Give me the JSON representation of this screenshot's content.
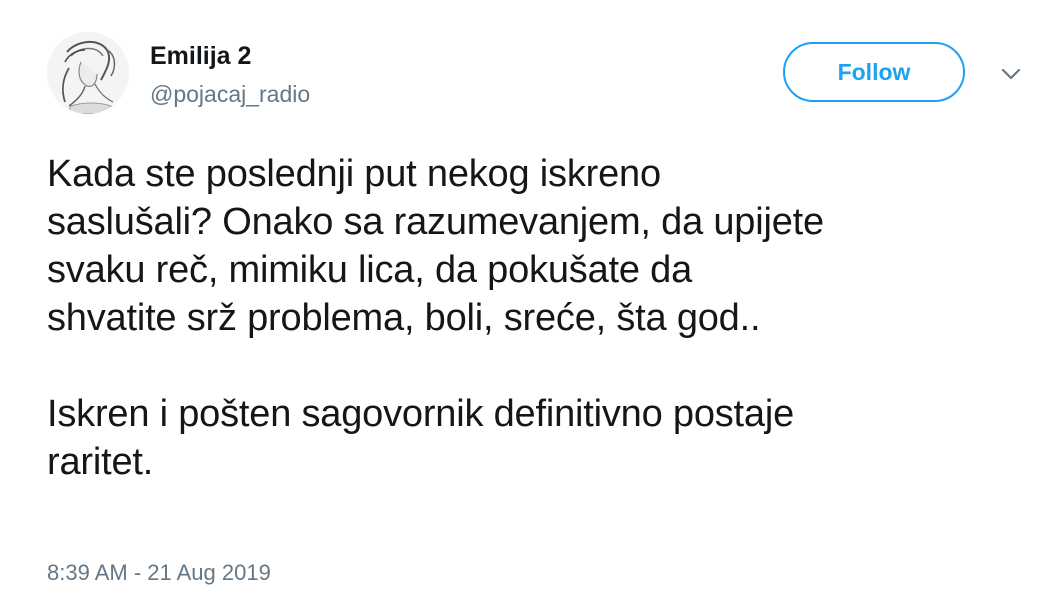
{
  "user": {
    "display_name": "Emilija 2",
    "handle": "@pojacaj_radio",
    "avatar_icon": "avatar-sketch-portrait"
  },
  "actions": {
    "follow_label": "Follow",
    "more_icon": "chevron-down-icon"
  },
  "tweet": {
    "text": "Kada ste poslednji put nekog iskreno\nsaslušali? Onako sa razumevanjem, da upijete\nsvaku reč, mimiku lica, da pokušate da\nshvatite srž problema, boli, sreće, šta god..\n\nIskren i pošten sagovornik definitivno postaje\nraritet.",
    "timestamp": "8:39 AM - 21 Aug 2019"
  },
  "colors": {
    "accent": "#1da1f2",
    "text_primary": "#14171a",
    "text_secondary": "#657786"
  }
}
